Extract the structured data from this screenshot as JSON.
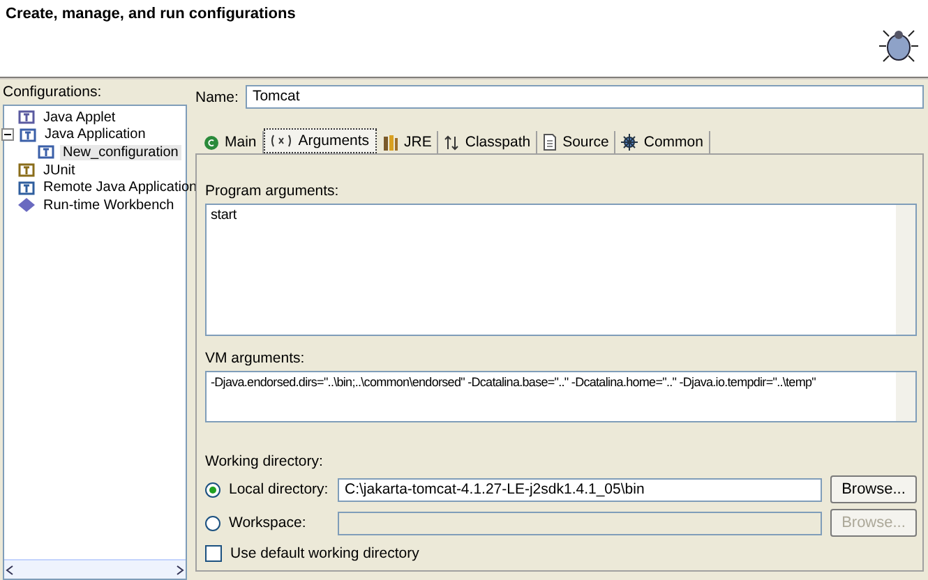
{
  "header": {
    "title": "Create, manage, and run configurations"
  },
  "configurations": {
    "label": "Configurations:",
    "tree": [
      {
        "label": "Java Applet",
        "kind": "applet",
        "selected": false
      },
      {
        "label": "Java Application",
        "kind": "app",
        "selected": false,
        "expanded": true,
        "children": [
          {
            "label": "New_configuration",
            "kind": "app",
            "selected": true
          }
        ]
      },
      {
        "label": "JUnit",
        "kind": "junit",
        "selected": false
      },
      {
        "label": "Remote Java Application",
        "kind": "remote",
        "selected": false
      },
      {
        "label": "Run-time Workbench",
        "kind": "workbench",
        "selected": false
      }
    ]
  },
  "name": {
    "label": "Name:",
    "value": "Tomcat"
  },
  "tabs": [
    {
      "label": "Main",
      "kind": "main",
      "selected": false
    },
    {
      "label": "Arguments",
      "kind": "args",
      "selected": true
    },
    {
      "label": "JRE",
      "kind": "jre",
      "selected": false
    },
    {
      "label": "Classpath",
      "kind": "classpath",
      "selected": false
    },
    {
      "label": "Source",
      "kind": "source",
      "selected": false
    },
    {
      "label": "Common",
      "kind": "common",
      "selected": false
    }
  ],
  "program_arguments": {
    "label": "Program arguments:",
    "value": "start"
  },
  "vm_arguments": {
    "label": "VM arguments:",
    "value": "-Djava.endorsed.dirs=\"..\\bin;..\\common\\endorsed\" -Dcatalina.base=\"..\" -Dcatalina.home=\"..\" -Djava.io.tempdir=\"..\\temp\""
  },
  "working_directory": {
    "label": "Working directory:",
    "options": [
      {
        "label": "Local directory:",
        "selected": true,
        "value": "C:\\jakarta-tomcat-4.1.27-LE-j2sdk1.4.1_05\\bin",
        "button": "Browse...",
        "disabled": false
      },
      {
        "label": "Workspace:",
        "selected": false,
        "button": "Browse...",
        "disabled": true
      }
    ],
    "use_default": {
      "label": "Use default working directory",
      "checked": false
    }
  }
}
